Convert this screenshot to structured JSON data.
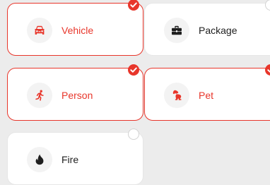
{
  "accent_color": "#e8362b",
  "options": [
    {
      "label": "Vehicle",
      "icon": "car-icon",
      "selected": true
    },
    {
      "label": "Package",
      "icon": "toolbox-icon",
      "selected": false
    },
    {
      "label": "Person",
      "icon": "running-person-icon",
      "selected": true
    },
    {
      "label": "Pet",
      "icon": "dog-icon",
      "selected": true
    },
    {
      "label": "Fire",
      "icon": "flame-icon",
      "selected": false
    }
  ]
}
